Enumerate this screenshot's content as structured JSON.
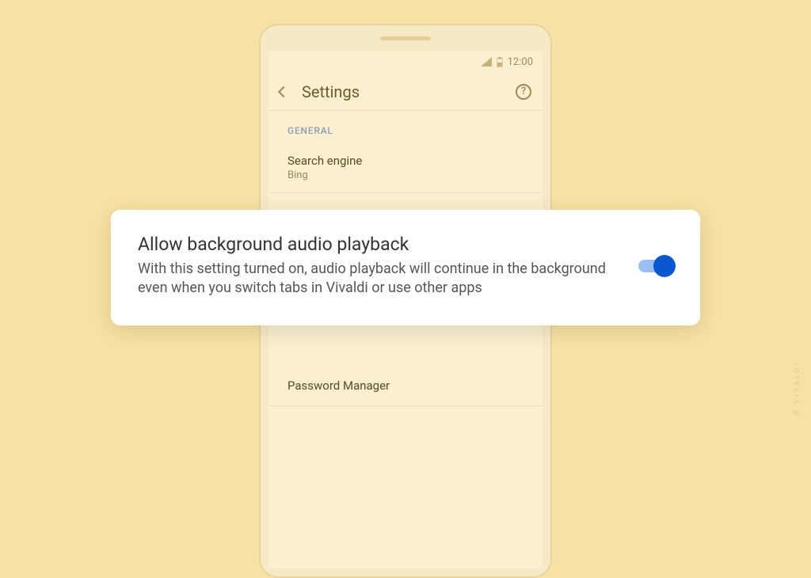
{
  "statusbar": {
    "time": "12:00"
  },
  "header": {
    "title": "Settings"
  },
  "section": {
    "label": "GENERAL"
  },
  "settings": {
    "search_engine": {
      "title": "Search engine",
      "value": "Bing"
    },
    "password_manager": {
      "title": "Password Manager"
    }
  },
  "card": {
    "title": "Allow background audio playback",
    "description": "With this setting turned on, audio playback will continue in the background even when you switch tabs in Vivaldi or use other apps",
    "toggle_on": true
  },
  "watermark": "© VIVALDI"
}
